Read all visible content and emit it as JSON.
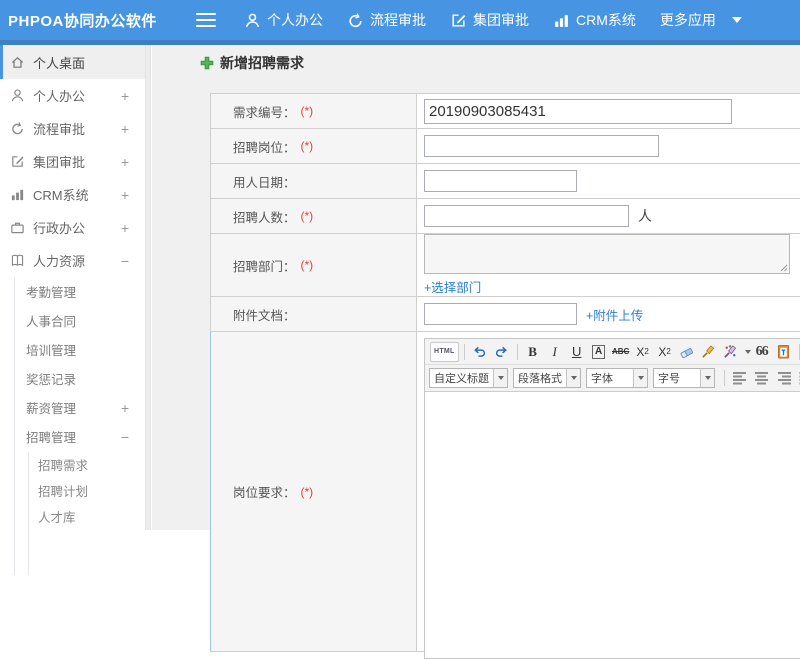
{
  "colors": {
    "header_blue": "#4795e2",
    "header_strip": "#3c80c4",
    "link_blue": "#2b7fd0",
    "required_red": "#e04040",
    "plus_green": "#54b554"
  },
  "header": {
    "app_title": "PHPOA协同办公软件",
    "nav": [
      {
        "label": "个人办公",
        "icon": "person-icon"
      },
      {
        "label": "流程审批",
        "icon": "flow-approval-icon"
      },
      {
        "label": "集团审批",
        "icon": "edit-square-icon"
      },
      {
        "label": "CRM系统",
        "icon": "bar-chart-icon"
      },
      {
        "label": "更多应用",
        "icon": "caret-down-icon"
      }
    ]
  },
  "sidebar": {
    "items": [
      {
        "label": "个人桌面",
        "level": 1,
        "icon": "home-icon",
        "expand": "",
        "active": true
      },
      {
        "label": "个人办公",
        "level": 1,
        "icon": "person-icon",
        "expand": "+"
      },
      {
        "label": "流程审批",
        "level": 1,
        "icon": "flow-approval-icon",
        "expand": "+"
      },
      {
        "label": "集团审批",
        "level": 1,
        "icon": "edit-square-icon",
        "expand": "+"
      },
      {
        "label": "CRM系统",
        "level": 1,
        "icon": "bar-chart-icon",
        "expand": "+"
      },
      {
        "label": "行政办公",
        "level": 1,
        "icon": "briefcase-icon",
        "expand": "+"
      },
      {
        "label": "人力资源",
        "level": 1,
        "icon": "open-book-icon",
        "expand": "−"
      },
      {
        "label": "考勤管理",
        "level": 2,
        "expand": ""
      },
      {
        "label": "人事合同",
        "level": 2,
        "expand": ""
      },
      {
        "label": "培训管理",
        "level": 2,
        "expand": ""
      },
      {
        "label": "奖惩记录",
        "level": 2,
        "expand": ""
      },
      {
        "label": "薪资管理",
        "level": 2,
        "expand": "+"
      },
      {
        "label": "招聘管理",
        "level": 2,
        "expand": "−"
      },
      {
        "label": "招聘需求",
        "level": 3,
        "expand": ""
      },
      {
        "label": "招聘计划",
        "level": 3,
        "expand": ""
      },
      {
        "label": "人才库",
        "level": 3,
        "expand": ""
      }
    ]
  },
  "main": {
    "page_title": "新增招聘需求",
    "form": {
      "required_marker": "(*)",
      "rows": [
        {
          "label": "需求编号：",
          "required": true,
          "value": "20190903085431"
        },
        {
          "label": "招聘岗位：",
          "required": true,
          "value": ""
        },
        {
          "label": "用人日期：",
          "required": false,
          "value": ""
        },
        {
          "label": "招聘人数：",
          "required": true,
          "value": "",
          "suffix": "人"
        },
        {
          "label": "招聘部门：",
          "required": true,
          "value": "",
          "link": "+选择部门"
        },
        {
          "label": "附件文档：",
          "required": false,
          "value": "",
          "link": "+附件上传"
        },
        {
          "label": "岗位要求：",
          "required": true
        }
      ]
    },
    "editor": {
      "toolbar": {
        "source_label": "HTML",
        "bold": "B",
        "italic": "I",
        "underline": "U",
        "anchor": "A",
        "strike": "ABC",
        "sup_base": "X",
        "sup_exp": "2",
        "sub_base": "X",
        "sub_exp": "2",
        "quote": "66",
        "paste_letter": "T",
        "font_color": "A",
        "highlight": "a",
        "selects": [
          "自定义标题",
          "段落格式",
          "字体",
          "字号"
        ]
      }
    }
  }
}
